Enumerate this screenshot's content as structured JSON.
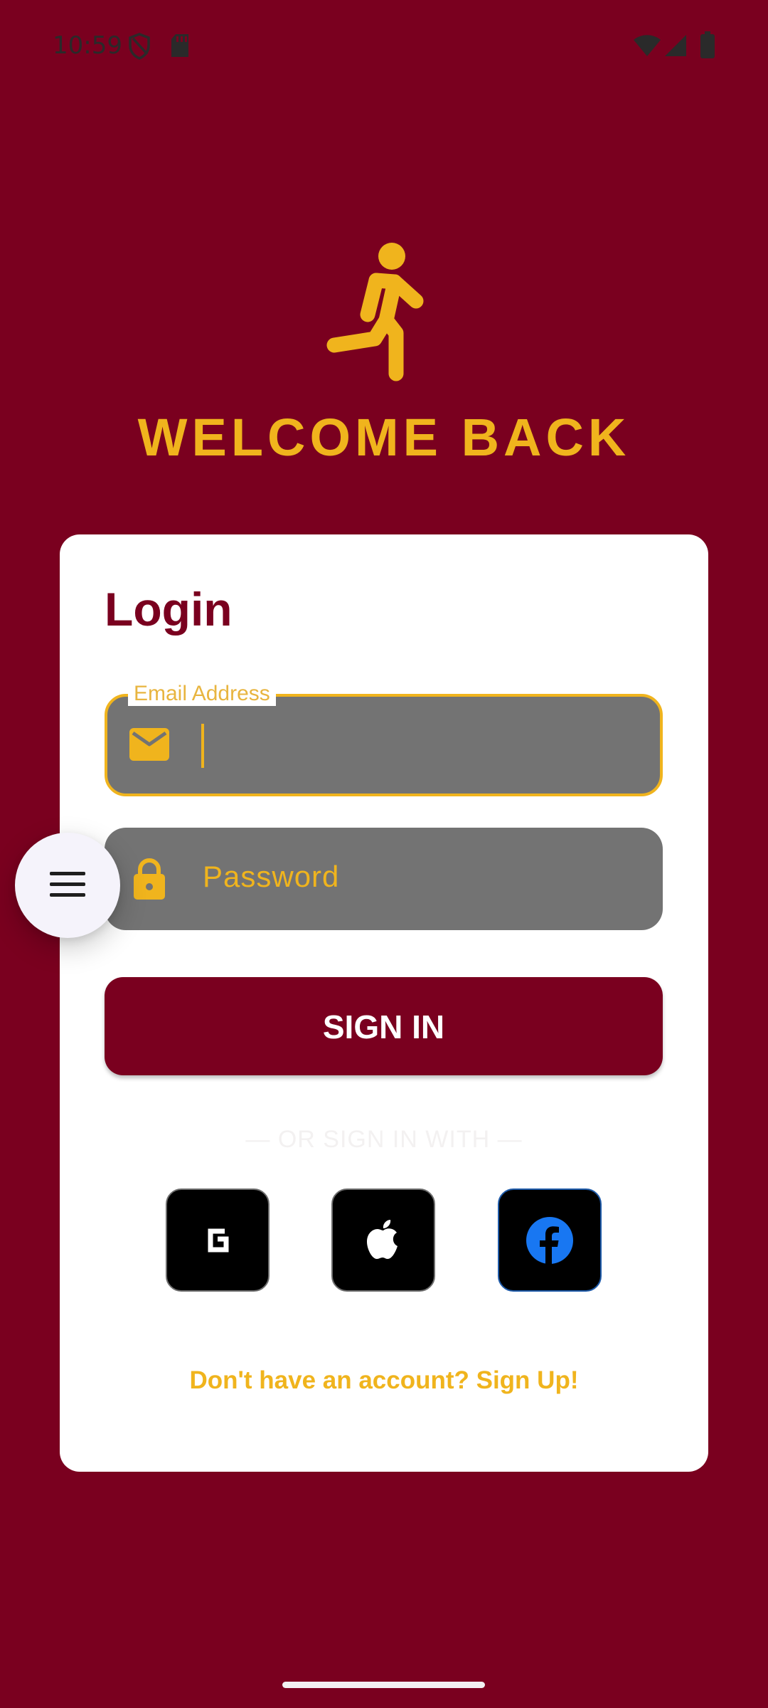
{
  "status_bar": {
    "time": "10:59",
    "icons": [
      "shield-icon",
      "sd-card-icon",
      "wifi-icon",
      "signal-icon",
      "battery-icon"
    ]
  },
  "header": {
    "icon": "running-person-icon",
    "title": "WELCOME BACK"
  },
  "login_card": {
    "title": "Login",
    "email": {
      "label": "Email Address",
      "value": "",
      "icon": "mail-icon"
    },
    "password": {
      "placeholder": "Password",
      "icon": "lock-icon"
    },
    "sign_in_label": "SIGN IN",
    "divider": "— OR SIGN IN WITH —",
    "social": [
      {
        "name": "google",
        "icon": "google-g-icon"
      },
      {
        "name": "apple",
        "icon": "apple-icon"
      },
      {
        "name": "facebook",
        "icon": "facebook-icon"
      }
    ],
    "signup_text": "Don't have an account? Sign Up!"
  },
  "fab": {
    "icon": "menu-icon"
  },
  "colors": {
    "background": "#7a001f",
    "accent": "#f0b41d",
    "field": "#737373",
    "card": "#ffffff"
  }
}
